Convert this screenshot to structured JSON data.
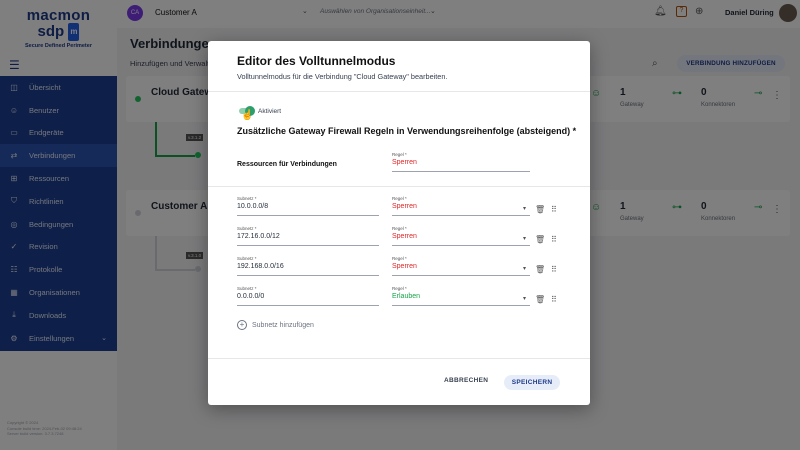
{
  "app": {
    "logo_line1": "macmon",
    "logo_line2": "sdp",
    "logo_badge": "m",
    "logo_tagline": "Secure Defined Perimeter",
    "footer_lines": [
      "Copyright © 2024",
      "Console build time: 2024-Feb-02 09:48:24",
      "Server build version: 3.7.3.7248"
    ]
  },
  "topbar": {
    "customer_initials": "CA",
    "customer_value": "Customer A",
    "org_placeholder": "Auswählen von Organisationseinheit...",
    "user_name": "Daniel Düring"
  },
  "sidebar": {
    "items": [
      {
        "icon": "◫",
        "label": "Übersicht",
        "active": false
      },
      {
        "icon": "☺",
        "label": "Benutzer",
        "active": false
      },
      {
        "icon": "▭",
        "label": "Endgeräte",
        "active": false
      },
      {
        "icon": "⇄",
        "label": "Verbindungen",
        "active": true
      },
      {
        "icon": "⊞",
        "label": "Ressourcen",
        "active": false
      },
      {
        "icon": "⛉",
        "label": "Richtlinien",
        "active": false
      },
      {
        "icon": "◎",
        "label": "Bedingungen",
        "active": false
      },
      {
        "icon": "✓",
        "label": "Revision",
        "active": false
      },
      {
        "icon": "☷",
        "label": "Protokolle",
        "active": false
      },
      {
        "icon": "▦",
        "label": "Organisationen",
        "active": false
      },
      {
        "icon": "⤓",
        "label": "Downloads",
        "active": false
      },
      {
        "icon": "⚙",
        "label": "Einstellungen",
        "active": false
      }
    ]
  },
  "page": {
    "title": "Verbindungen",
    "subtitle": "Hinzufügen und Verwalt",
    "add_button": "VERBINDUNG HINZUFÜGEN"
  },
  "cards": [
    {
      "title": "Cloud Gatew",
      "status_color": "#22c55e",
      "gateway_count": "1",
      "gateway_label": "Gateway",
      "connector_count": "0",
      "connector_label": "Konnektoren",
      "version_tag": "v.3.1.2"
    },
    {
      "title": "Customer A A",
      "status_color": "#d1d5db",
      "gateway_count": "1",
      "gateway_label": "Gateway",
      "connector_count": "0",
      "connector_label": "Konnektoren",
      "version_tag": "v.3.1.0"
    }
  ],
  "modal": {
    "title": "Editor des Volltunnelmodus",
    "subtitle": "Volltunnelmodus für die Verbindung \"Cloud Gateway\" bearbeiten.",
    "toggle_label": "Aktiviert",
    "toggle_on": true,
    "section_title": "Zusätzliche Gateway Firewall Regeln in Verwendungsreihenfolge (absteigend) *",
    "resources_label": "Ressourcen für Verbindungen",
    "resources_rule_label": "Regel *",
    "resources_rule_value": "Sperren",
    "subnet_label": "Subnetz *",
    "rule_label": "Regel *",
    "rows": [
      {
        "subnet": "10.0.0.0/8",
        "rule": "Sperren",
        "rule_color": "red"
      },
      {
        "subnet": "172.16.0.0/12",
        "rule": "Sperren",
        "rule_color": "red"
      },
      {
        "subnet": "192.168.0.0/16",
        "rule": "Sperren",
        "rule_color": "red"
      },
      {
        "subnet": "0.0.0.0/0",
        "rule": "Erlauben",
        "rule_color": "green"
      }
    ],
    "add_subnet_label": "Subnetz hinzufügen",
    "cancel_label": "ABBRECHEN",
    "save_label": "SPEICHERN"
  }
}
